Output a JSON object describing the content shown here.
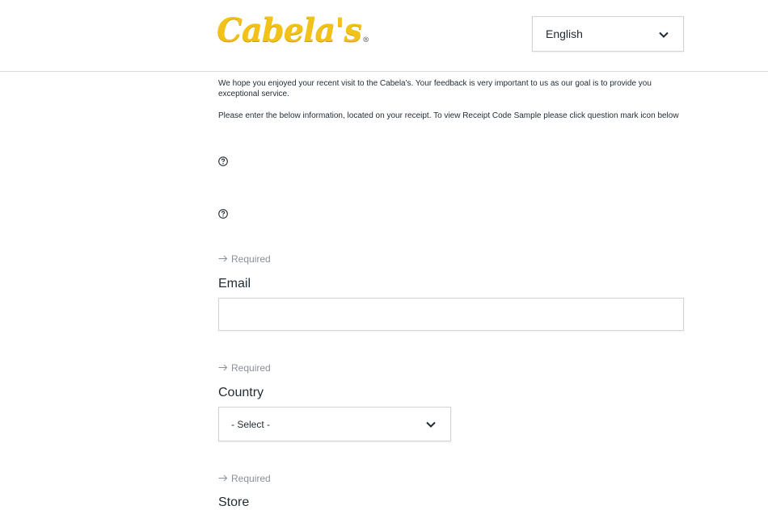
{
  "header": {
    "logo_text": "Cabela's",
    "logo_mark": "®",
    "language": {
      "selected": "English",
      "icon": "chevron-down-icon"
    }
  },
  "intro": {
    "paragraph1": "We hope you enjoyed your recent visit to the Cabela's. Your feedback is very important to us as our goal is to provide you exceptional service.",
    "paragraph2": "Please enter the below information, located on your receipt. To view Receipt Code Sample please click question mark icon below"
  },
  "help_icons": [
    "question-circle-icon",
    "question-circle-icon"
  ],
  "fields": {
    "email": {
      "required_text": "Required",
      "label": "Email",
      "value": "",
      "placeholder": ""
    },
    "country": {
      "required_text": "Required",
      "label": "Country",
      "selected": "- Select -"
    },
    "store": {
      "required_text": "Required",
      "label": "Store"
    }
  },
  "colors": {
    "brand_yellow": "#f2c218",
    "text": "#1f2a33",
    "muted": "#8a9096",
    "border": "#cfd4d8"
  }
}
